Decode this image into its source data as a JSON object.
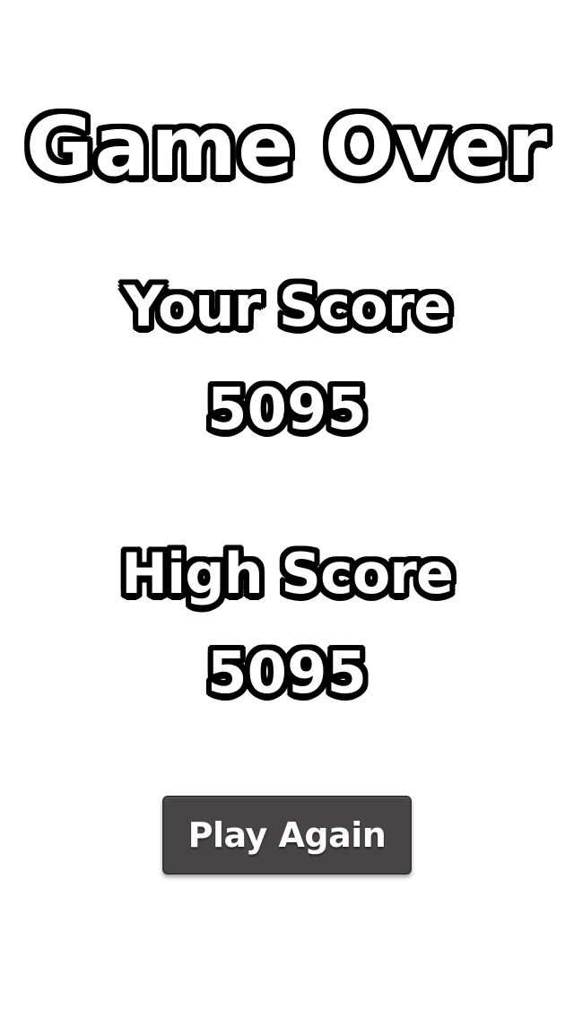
{
  "game_over": {
    "title": "Game Over",
    "your_score_label": "Your Score",
    "your_score_value": "5095",
    "high_score_label": "High Score",
    "high_score_value": "5095",
    "play_again_label": "Play Again"
  },
  "colors": {
    "background": "#ffffff",
    "text_fill": "#ffffff",
    "text_outline": "#000000",
    "button_background": "#4a4545"
  }
}
